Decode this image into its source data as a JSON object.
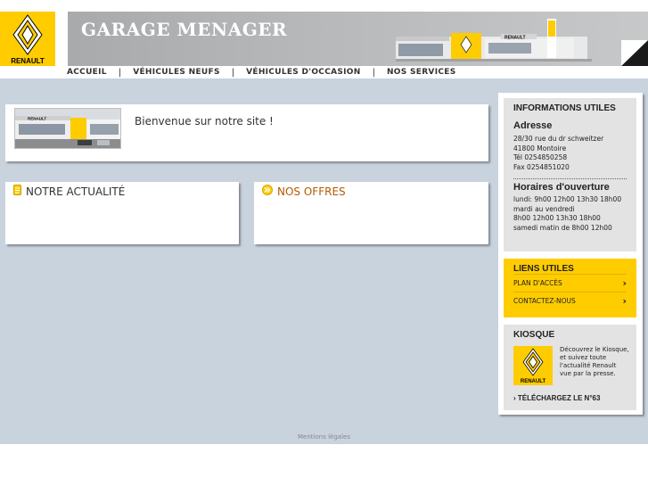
{
  "header": {
    "logo_text": "RENAULT",
    "site_title": "GARAGE MENAGER",
    "building_sign": "RENAULT"
  },
  "nav": {
    "items": [
      {
        "label": "ACCUEIL"
      },
      {
        "label": "VÉHICULES NEUFS"
      },
      {
        "label": "VÉHICULES D'OCCASION"
      },
      {
        "label": "NOS SERVICES"
      }
    ],
    "separator": "|"
  },
  "welcome": {
    "text": "Bienvenue sur notre site !",
    "photo_sign": "RENAULT"
  },
  "news": {
    "title": "NOTRE ACTUALITÉ",
    "icon": "document-icon"
  },
  "offers": {
    "title": "NOS OFFRES",
    "icon": "double-chevron-icon"
  },
  "info": {
    "title": "INFORMATIONS UTILES",
    "address_heading": "Adresse",
    "address_lines": [
      "28/30 rue du dr schweitzer",
      "41800 Montoire",
      "Tél 0254850258",
      "Fax 0254851020"
    ],
    "hours_heading": "Horaires d'ouverture",
    "hours_lines": [
      "lundi: 9h00 12h00 13h30 18h00",
      "mardi au vendredi",
      "8h00 12h00 13h30 18h00",
      "samedi matin de 8h00 12h00"
    ]
  },
  "links": {
    "title": "LIENS UTILES",
    "items": [
      {
        "label": "PLAN D'ACCÈS",
        "arrow": "›"
      },
      {
        "label": "CONTACTEZ-NOUS",
        "arrow": "›"
      }
    ]
  },
  "kiosk": {
    "title": "KIOSQUE",
    "logo_text": "RENAULT",
    "text": "Découvrez le Kiosque, et suivez toute l'actualité Renault vue par la presse.",
    "download_label": "› TÉLÉCHARGEZ LE N°63"
  },
  "footer": {
    "legal": "Mentions légales"
  },
  "colors": {
    "renault_yellow": "#ffcc00",
    "background_blue": "#c9d3dd",
    "panel_grey": "#e3e3e3",
    "offers_accent": "#b35a00"
  }
}
